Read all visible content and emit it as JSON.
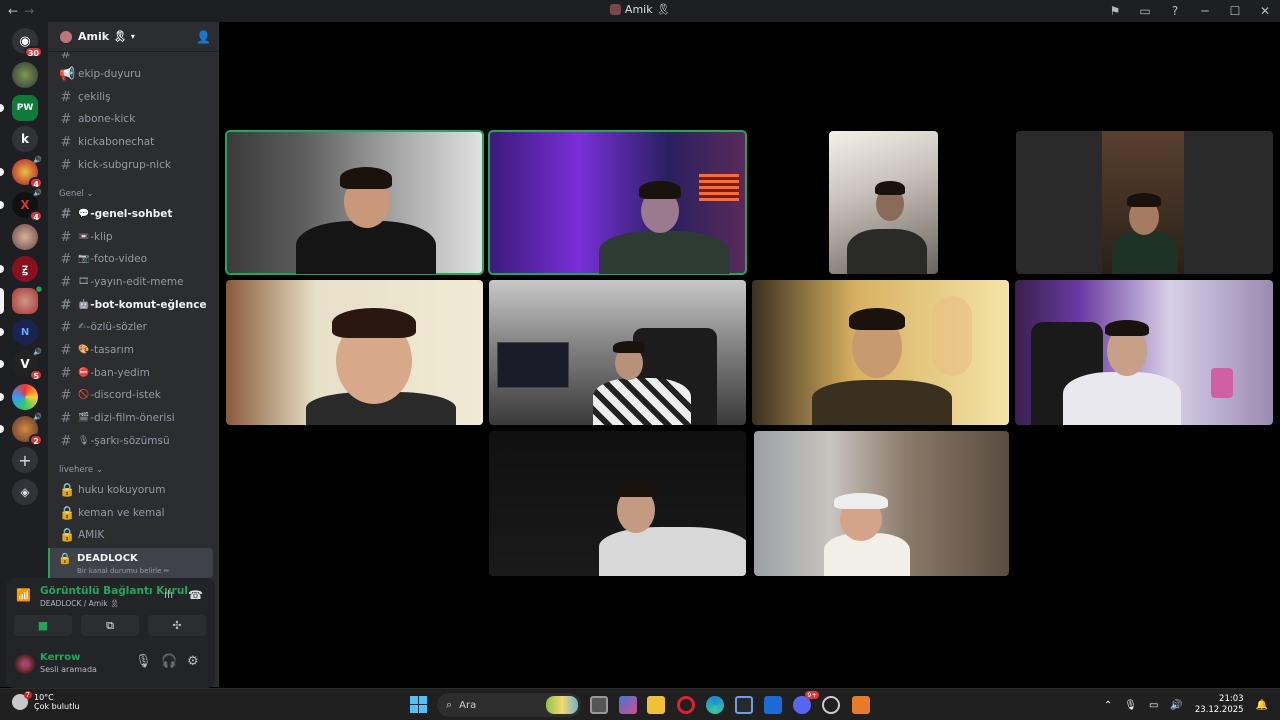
{
  "window": {
    "title": "Amik 🎗",
    "nav_back": "←",
    "nav_forward": "→"
  },
  "guild_rail": {
    "home_badge": "30",
    "servers": [
      {
        "name": "green-monster",
        "badge": ""
      },
      {
        "name": "pw",
        "label": "PW",
        "badge": ""
      },
      {
        "name": "k",
        "label": "k",
        "badge": ""
      },
      {
        "name": "fruit-server",
        "badge": "4"
      },
      {
        "name": "x-server",
        "label": "X",
        "badge": "4"
      },
      {
        "name": "face-server",
        "badge": ""
      },
      {
        "name": "red-logo-server",
        "badge": ""
      },
      {
        "name": "active-server",
        "badge": ""
      },
      {
        "name": "blue-logo-server",
        "badge": ""
      },
      {
        "name": "v-server",
        "label": "V",
        "badge": "5"
      },
      {
        "name": "colorful-server",
        "badge": ""
      },
      {
        "name": "bear-server",
        "badge": "2"
      }
    ]
  },
  "sidebar": {
    "server_name": "Amik 🎗",
    "top_channels": [
      {
        "name": "ekip-duyuru",
        "icon": "announcement-icon"
      },
      {
        "name": "çekiliş",
        "icon": "hash-icon"
      },
      {
        "name": "abone-kick",
        "icon": "hash-icon"
      },
      {
        "name": "kickabonechat",
        "icon": "hash-icon"
      },
      {
        "name": "kick-subgrup-nick",
        "icon": "hash-icon"
      }
    ],
    "genel_category": "Genel",
    "genel_channels": [
      {
        "prefix": "💬",
        "name": "-genel-sohbet",
        "bold": true
      },
      {
        "prefix": "📼",
        "name": "-klip",
        "bold": false
      },
      {
        "prefix": "📷",
        "name": "-foto-video",
        "bold": false
      },
      {
        "prefix": "🎞",
        "name": "-yayın-edit-meme",
        "bold": false
      },
      {
        "prefix": "🤖",
        "name": "-bot-komut-eğlence",
        "bold": true
      },
      {
        "prefix": "✍",
        "name": "-özlü-sözler",
        "bold": false
      },
      {
        "prefix": "🎨",
        "name": "-tasarım",
        "bold": false
      },
      {
        "prefix": "⛔",
        "name": "-ban-yedim",
        "bold": false
      },
      {
        "prefix": "🚫",
        "name": "-discord-istek",
        "bold": false
      },
      {
        "prefix": "🎬",
        "name": "-dizi-film-önerisi",
        "bold": false
      },
      {
        "prefix": "🎙",
        "name": "-şarkı-sözümsü",
        "bold": false
      }
    ],
    "livehere_category": "livehere",
    "voice_channels": [
      {
        "name": "huku kokuyorum"
      },
      {
        "name": "keman ve kemal"
      },
      {
        "name": "AMIK"
      }
    ],
    "active_voice": {
      "name": "DEADLOCK",
      "status_hint": "Bir kanal durumu belirle ✏"
    }
  },
  "voice_panel": {
    "status": "Görüntülü Bağlantı Kurul",
    "channel": "DEADLOCK / Amik 🎗",
    "camera_icon": "■",
    "screen_icon": "⧉",
    "activity_icon": "✣"
  },
  "user": {
    "name": "Kerrow",
    "status": "Sesli aramada"
  },
  "taskbar": {
    "temperature": "10°C",
    "weather": "Çok bulutlu",
    "weather_badge": "7",
    "search_placeholder": "Ara",
    "time": "21:03",
    "date": "23.12.2025",
    "discord_badge": "9+"
  },
  "video_tiles": [
    {
      "name": "participant-1",
      "speaking": true
    },
    {
      "name": "participant-2",
      "speaking": true
    },
    {
      "name": "participant-3",
      "speaking": false
    },
    {
      "name": "participant-4",
      "speaking": false
    },
    {
      "name": "participant-5",
      "speaking": false
    },
    {
      "name": "participant-6",
      "speaking": false
    },
    {
      "name": "participant-7",
      "speaking": false
    },
    {
      "name": "participant-8",
      "speaking": false
    },
    {
      "name": "participant-9",
      "speaking": false
    },
    {
      "name": "participant-10",
      "speaking": false
    }
  ]
}
